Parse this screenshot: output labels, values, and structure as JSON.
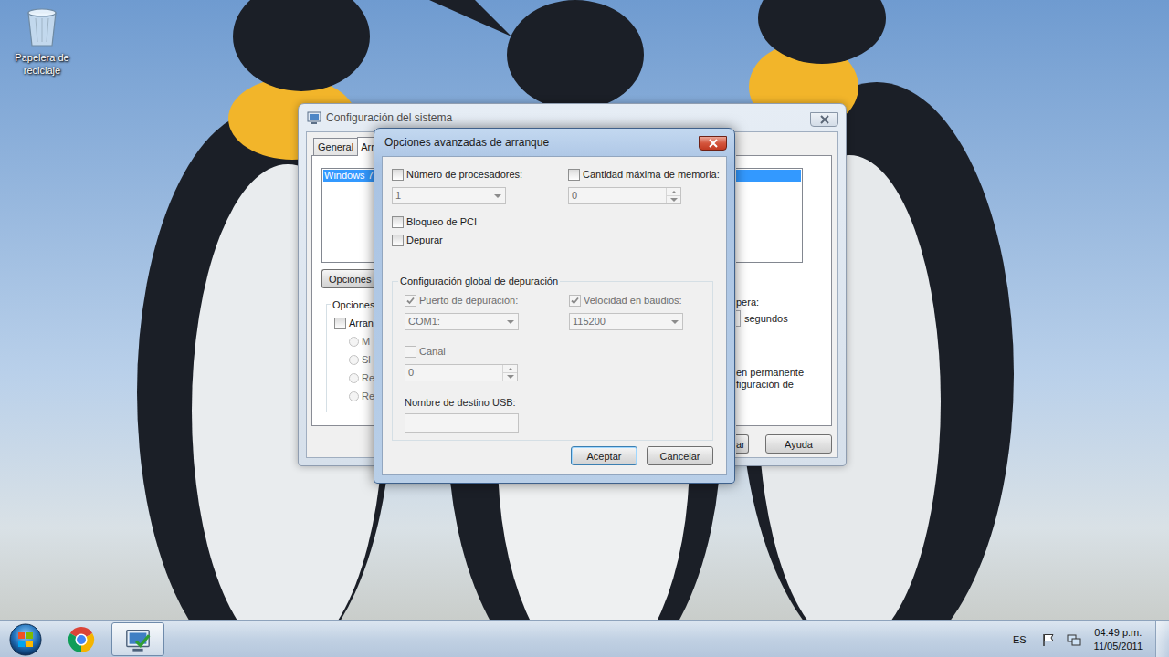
{
  "desktop": {
    "icons": [
      {
        "label": "Papelera de reciclaje",
        "kind": "recycle-bin"
      }
    ]
  },
  "back_window": {
    "title": "Configuración del sistema",
    "active": false,
    "tabs": [
      {
        "label": "General",
        "selected": false
      },
      {
        "label": "Arr",
        "selected": true
      }
    ],
    "boot_list": {
      "label": "Windows 7",
      "selected": true
    },
    "options_button": "Opciones",
    "group": {
      "label": "Opciones",
      "checkbox": {
        "label": "Arran",
        "checked": false
      },
      "radios": [
        {
          "label": "M",
          "selected": false,
          "disabled": true
        },
        {
          "label": "Sl",
          "selected": false,
          "disabled": true
        },
        {
          "label": "Re",
          "selected": false,
          "disabled": true
        },
        {
          "label": "Re",
          "selected": false,
          "disabled": true
        }
      ]
    },
    "timeout": {
      "label": "pera:",
      "unit": "segundos"
    },
    "note": [
      "en permanente",
      "figuración de"
    ],
    "buttons": [
      "ar",
      "Ayuda"
    ]
  },
  "dialog": {
    "title": "Opciones avanzadas de arranque",
    "active": true,
    "options": [
      {
        "label": "Número de procesadores:",
        "checked": false,
        "disabled": false,
        "field": {
          "kind": "dropdown",
          "value": "1",
          "disabled": true
        }
      },
      {
        "label": "Cantidad máxima de memoria:",
        "checked": false,
        "disabled": false,
        "field": {
          "kind": "spinner",
          "value": "0",
          "disabled": true
        }
      }
    ],
    "flags": [
      {
        "label": "Bloqueo de PCI",
        "checked": false,
        "disabled": false
      },
      {
        "label": "Depurar",
        "checked": false,
        "disabled": false
      }
    ],
    "debug_group": {
      "label": "Configuración global de depuración",
      "settings": [
        {
          "label": "Puerto de depuración:",
          "checked": true,
          "disabled": true,
          "field": {
            "kind": "dropdown",
            "value": "COM1:",
            "disabled": true
          }
        },
        {
          "label": "Velocidad en baudios:",
          "checked": true,
          "disabled": true,
          "field": {
            "kind": "dropdown",
            "value": "115200",
            "disabled": true
          }
        },
        {
          "label": "Canal",
          "checked": false,
          "disabled": true,
          "field": {
            "kind": "spinner",
            "value": "0",
            "disabled": true
          }
        }
      ],
      "usb_target": {
        "label": "Nombre de destino USB:",
        "value": "",
        "disabled": true
      }
    },
    "buttons": [
      {
        "label": "Aceptar",
        "default": true
      },
      {
        "label": "Cancelar",
        "default": false
      }
    ]
  },
  "taskbar": {
    "apps": [
      {
        "kind": "chrome",
        "active": false
      },
      {
        "kind": "msconfig",
        "active": true
      }
    ],
    "language": "ES",
    "time": "04:49 p.m.",
    "date": "11/05/2011"
  }
}
